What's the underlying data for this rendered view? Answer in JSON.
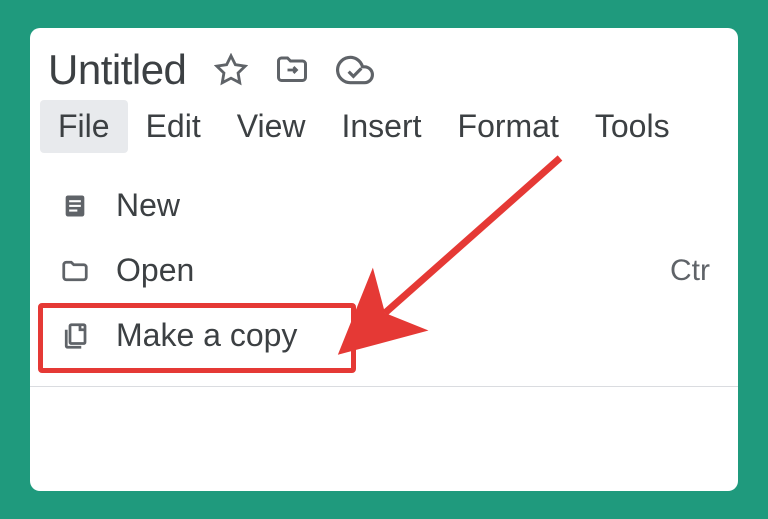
{
  "header": {
    "title": "Untitled"
  },
  "menubar": {
    "items": [
      {
        "label": "File",
        "active": true
      },
      {
        "label": "Edit",
        "active": false
      },
      {
        "label": "View",
        "active": false
      },
      {
        "label": "Insert",
        "active": false
      },
      {
        "label": "Format",
        "active": false
      },
      {
        "label": "Tools",
        "active": false
      }
    ]
  },
  "dropdown": {
    "items": [
      {
        "icon": "doc",
        "label": "New",
        "shortcut": ""
      },
      {
        "icon": "folder",
        "label": "Open",
        "shortcut": "Ctr"
      },
      {
        "icon": "copy",
        "label": "Make a copy",
        "shortcut": ""
      }
    ]
  }
}
